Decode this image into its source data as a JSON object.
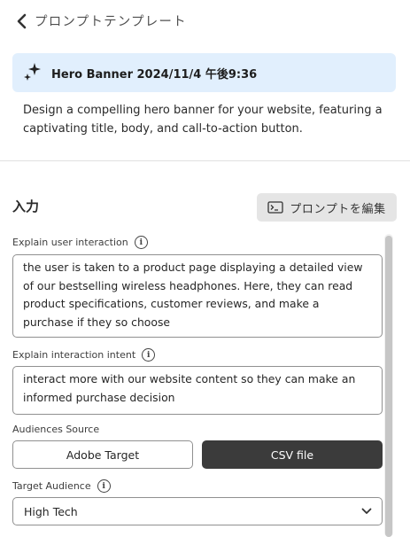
{
  "header": {
    "back_label": "プロンプトテンプレート"
  },
  "banner": {
    "title": "Hero Banner 2024/11/4 午後9:36",
    "icon": "sparkle-icon",
    "background": "#e1effd"
  },
  "description": "Design a compelling hero banner for your website, featuring a captivating title, body, and call-to-action button.",
  "input_section": {
    "title": "入力",
    "edit_button_label": "プロンプトを編集"
  },
  "fields": {
    "user_interaction": {
      "label": "Explain user interaction",
      "value": "the user is taken to a product page displaying a detailed view of our bestselling wireless headphones. Here, they can read product specifications, customer reviews, and make a purchase if they so choose"
    },
    "interaction_intent": {
      "label": "Explain interaction intent",
      "value": "interact more with our website content so they can make an informed purchase decision"
    },
    "audiences_source": {
      "label": "Audiences Source",
      "options": [
        "Adobe Target",
        "CSV file"
      ],
      "selected": "CSV file"
    },
    "target_audience": {
      "label": "Target Audience",
      "value": "High Tech"
    }
  },
  "colors": {
    "selected_segment": "#3b3b3b",
    "banner_bg": "#e1effd"
  }
}
